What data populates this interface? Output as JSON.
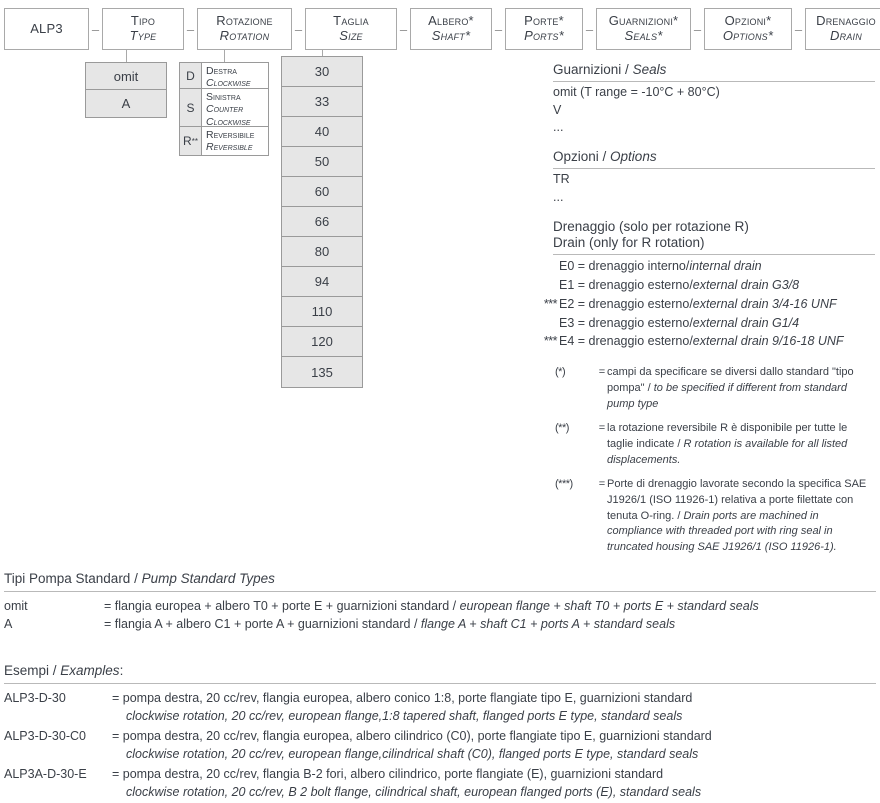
{
  "diagram": {
    "header_boxes": [
      {
        "name": "alp3",
        "it": "ALP3",
        "en": ""
      },
      {
        "name": "tipo",
        "it": "Tipo",
        "en": "Type"
      },
      {
        "name": "rot",
        "it": "Rotazione",
        "en": "Rotation"
      },
      {
        "name": "size",
        "it": "Taglia",
        "en": "Size"
      },
      {
        "name": "shaft",
        "it": "Albero*",
        "en": "Shaft*"
      },
      {
        "name": "ports",
        "it": "Porte*",
        "en": "Ports*"
      },
      {
        "name": "seals",
        "it": "Guarnizioni*",
        "en": "Seals*"
      },
      {
        "name": "opts",
        "it": "Opzioni*",
        "en": "Options*"
      },
      {
        "name": "drain",
        "it": "Drenaggio",
        "en": "Drain"
      }
    ],
    "separator": "–",
    "type_options": [
      "omit",
      "A"
    ],
    "rotation_options": [
      {
        "code": "D",
        "sup": "",
        "it": "Destra",
        "en": "Clockwise"
      },
      {
        "code": "S",
        "sup": "",
        "it": "Sinistra",
        "en": "Counter Clockwise"
      },
      {
        "code": "R",
        "sup": "**",
        "it": "Reversibile",
        "en": "Reversible"
      }
    ],
    "size_options": [
      "30",
      "33",
      "40",
      "50",
      "60",
      "66",
      "80",
      "94",
      "110",
      "120",
      "135"
    ]
  },
  "seals": {
    "title_it": "Guarnizioni",
    "title_sep": " / ",
    "title_en": "Seals",
    "lines": [
      "omit (T range = -10°C + 80°C)",
      "V",
      "..."
    ]
  },
  "options": {
    "title_it": "Opzioni",
    "title_sep": " / ",
    "title_en": "Options",
    "lines": [
      "TR",
      "..."
    ]
  },
  "drain": {
    "title_it": "Drenaggio (solo per rotazione R)",
    "title_en": "Drain (only for R rotation)",
    "items": [
      {
        "mark": "",
        "code": "E0 = ",
        "it": "drenaggio interno/",
        "en": "internal drain"
      },
      {
        "mark": "",
        "code": "E1 = ",
        "it": "drenaggio esterno/",
        "en": "external drain G3/8"
      },
      {
        "mark": "***",
        "code": "E2 = ",
        "it": "drenaggio esterno/",
        "en": "external drain 3/4-16 UNF"
      },
      {
        "mark": "",
        "code": "E3 = ",
        "it": "drenaggio esterno/",
        "en": "external drain G1/4"
      },
      {
        "mark": "***",
        "code": "E4 = ",
        "it": "drenaggio esterno/",
        "en": "external drain 9/16-18 UNF"
      }
    ]
  },
  "footnotes": [
    {
      "mark": "(*)",
      "eq": "=",
      "it": "campi da specificare se diversi dallo standard \"tipo pompa\" / ",
      "en": "to be specified if different from standard pump type"
    },
    {
      "mark": "(**)",
      "eq": "=",
      "it": "la rotazione reversibile R è disponibile per tutte le taglie indicate / ",
      "en": "R rotation is available for all listed displacements."
    },
    {
      "mark": "(***)",
      "eq": "=",
      "it": "Porte di drenaggio lavorate secondo la specifica SAE J1926/1 (ISO 11926-1) relativa a porte filettate con tenuta O-ring. / ",
      "en": "Drain ports are machined in compliance with threaded port with ring seal in truncated housing SAE J1926/1 (ISO 11926-1)."
    }
  ],
  "standard_types": {
    "title_it": "Tipi Pompa Standard",
    "title_sep": " / ",
    "title_en": "Pump Standard Types",
    "rows": [
      {
        "code": "omit",
        "it": "= flangia europea + albero T0 + porte E + guarnizioni standard / ",
        "en": "european flange + shaft T0 + ports E + standard seals"
      },
      {
        "code": "A",
        "it": "= flangia A + albero C1 + porte A + guarnizioni standard / ",
        "en": "flange A + shaft C1 + ports A + standard seals"
      }
    ]
  },
  "examples": {
    "title_it": "Esempi",
    "title_sep": " / ",
    "title_en": "Examples",
    "title_colon": ":",
    "rows": [
      {
        "code": "ALP3-D-30",
        "line1": "= pompa destra, 20 cc/rev, flangia europea, albero conico 1:8, porte flangiate tipo E, guarnizioni standard",
        "line2": "clockwise rotation, 20 cc/rev, european flange,1:8 tapered shaft, flanged ports E type, standard seals"
      },
      {
        "code": "ALP3-D-30-C0",
        "line1": "= pompa destra, 20 cc/rev, flangia europea, albero cilindrico (C0), porte flangiate tipo E, guarnizioni standard",
        "line2": "clockwise rotation, 20 cc/rev, european flange,cilindrical shaft (C0), flanged ports E type, standard seals"
      },
      {
        "code": "ALP3A-D-30-E",
        "line1": "= pompa destra, 20 cc/rev, flangia B-2 fori, albero cilindrico, porte flangiate (E), guarnizioni standard",
        "line2": "clockwise rotation, 20 cc/rev, B 2 bolt flange, cilindrical shaft, european flanged ports (E), standard seals"
      }
    ]
  }
}
